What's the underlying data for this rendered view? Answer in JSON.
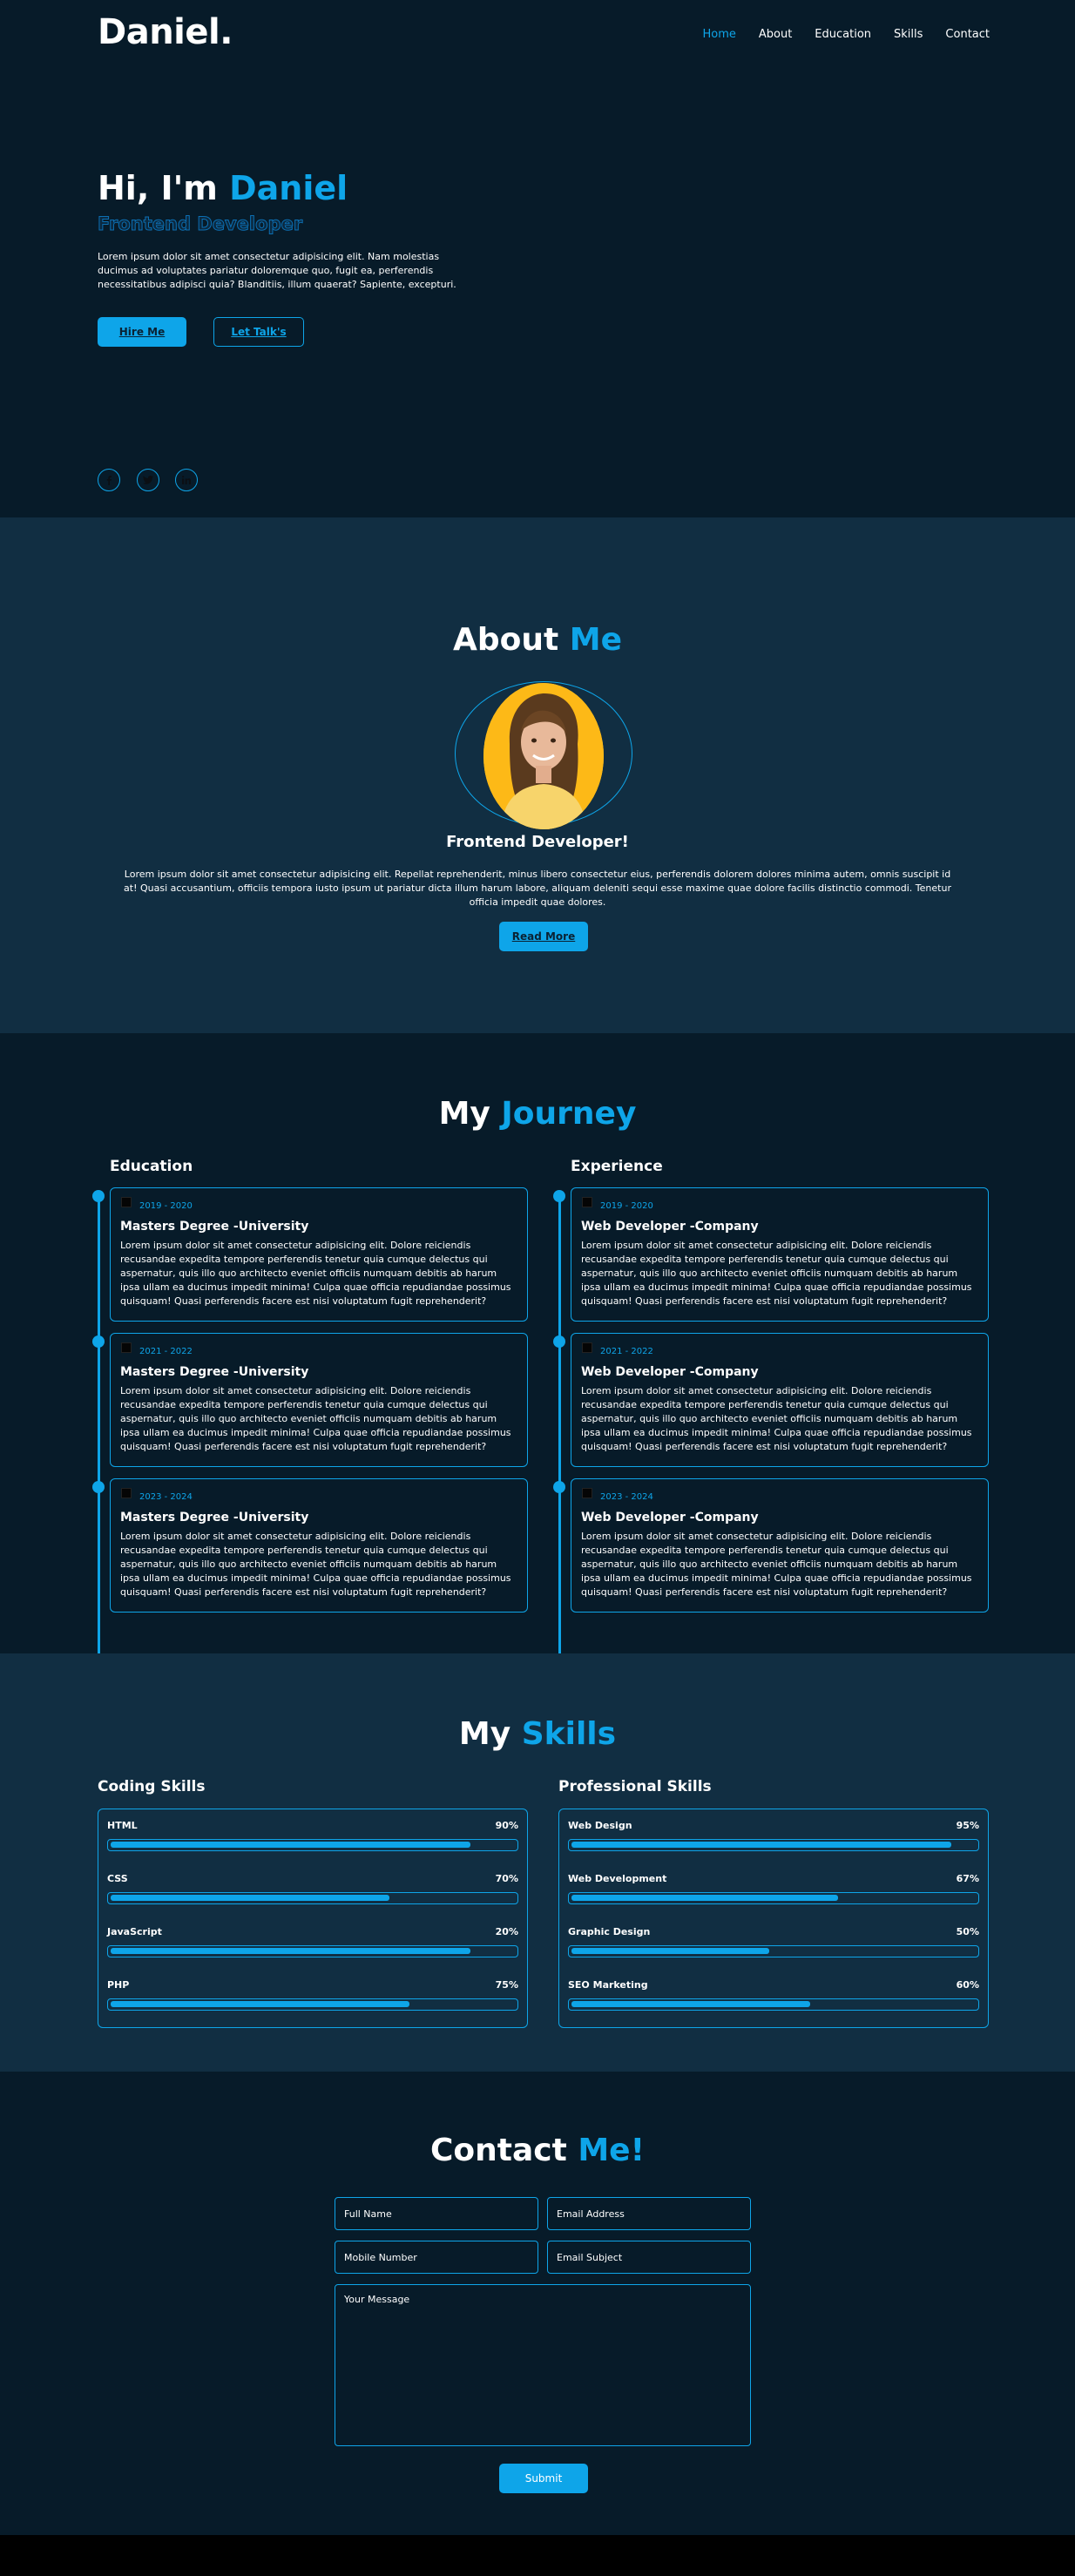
{
  "brand": {
    "logo": "Daniel.",
    "accent": "#0ea5e9"
  },
  "nav": [
    {
      "label": "Home",
      "active": true
    },
    {
      "label": "About",
      "active": false
    },
    {
      "label": "Education",
      "active": false
    },
    {
      "label": "Skills",
      "active": false
    },
    {
      "label": "Contact",
      "active": false
    }
  ],
  "hero": {
    "greeting": "Hi, I'm",
    "name": "Daniel",
    "role": "Frontend Developer",
    "description": "Lorem ipsum dolor sit amet consectetur adipisicing elit. Nam molestias ducimus ad voluptates pariatur doloremque quo, fugit ea, perferendis necessitatibus adipisci quia? Blanditiis, illum quaerat? Sapiente, excepturi.",
    "hire_button": "Hire Me",
    "talk_button": "Let Talk's",
    "social": [
      "facebook-icon",
      "twitter-icon",
      "linkedin-icon"
    ]
  },
  "about": {
    "title": "About",
    "title_accent": "Me",
    "role": "Frontend Developer!",
    "description": "Lorem ipsum dolor sit amet consectetur adipisicing elit. Repellat reprehenderit, minus libero consectetur eius, perferendis dolorem dolores minima autem, omnis suscipit id at! Quasi accusantium, officiis tempora iusto ipsum ut pariatur dicta illum harum labore, aliquam deleniti sequi esse maxime quae dolore facilis distinctio commodi. Tenetur officia impedit quae dolores.",
    "read_more": "Read More"
  },
  "journey": {
    "title": "My",
    "title_accent": "Journey",
    "education": {
      "heading": "Education",
      "items": [
        {
          "date": "2019 - 2020",
          "title": "Masters Degree -University",
          "text": "Lorem ipsum dolor sit amet consectetur adipisicing elit. Dolore reiciendis recusandae expedita tempore perferendis tenetur quia cumque delectus qui aspernatur, quis illo quo architecto eveniet officiis numquam debitis ab harum ipsa ullam ea ducimus impedit minima! Culpa quae officia repudiandae possimus quisquam! Quasi perferendis facere est nisi voluptatum fugit reprehenderit?"
        },
        {
          "date": "2021 - 2022",
          "title": "Masters Degree -University",
          "text": "Lorem ipsum dolor sit amet consectetur adipisicing elit. Dolore reiciendis recusandae expedita tempore perferendis tenetur quia cumque delectus qui aspernatur, quis illo quo architecto eveniet officiis numquam debitis ab harum ipsa ullam ea ducimus impedit minima! Culpa quae officia repudiandae possimus quisquam! Quasi perferendis facere est nisi voluptatum fugit reprehenderit?"
        },
        {
          "date": "2023 - 2024",
          "title": "Masters Degree -University",
          "text": "Lorem ipsum dolor sit amet consectetur adipisicing elit. Dolore reiciendis recusandae expedita tempore perferendis tenetur quia cumque delectus qui aspernatur, quis illo quo architecto eveniet officiis numquam debitis ab harum ipsa ullam ea ducimus impedit minima! Culpa quae officia repudiandae possimus quisquam! Quasi perferendis facere est nisi voluptatum fugit reprehenderit?"
        }
      ]
    },
    "experience": {
      "heading": "Experience",
      "items": [
        {
          "date": "2019 - 2020",
          "title": "Web Developer -Company",
          "text": "Lorem ipsum dolor sit amet consectetur adipisicing elit. Dolore reiciendis recusandae expedita tempore perferendis tenetur quia cumque delectus qui aspernatur, quis illo quo architecto eveniet officiis numquam debitis ab harum ipsa ullam ea ducimus impedit minima! Culpa quae officia repudiandae possimus quisquam! Quasi perferendis facere est nisi voluptatum fugit reprehenderit?"
        },
        {
          "date": "2021 - 2022",
          "title": "Web Developer -Company",
          "text": "Lorem ipsum dolor sit amet consectetur adipisicing elit. Dolore reiciendis recusandae expedita tempore perferendis tenetur quia cumque delectus qui aspernatur, quis illo quo architecto eveniet officiis numquam debitis ab harum ipsa ullam ea ducimus impedit minima! Culpa quae officia repudiandae possimus quisquam! Quasi perferendis facere est nisi voluptatum fugit reprehenderit?"
        },
        {
          "date": "2023 - 2024",
          "title": "Web Developer -Company",
          "text": "Lorem ipsum dolor sit amet consectetur adipisicing elit. Dolore reiciendis recusandae expedita tempore perferendis tenetur quia cumque delectus qui aspernatur, quis illo quo architecto eveniet officiis numquam debitis ab harum ipsa ullam ea ducimus impedit minima! Culpa quae officia repudiandae possimus quisquam! Quasi perferendis facere est nisi voluptatum fugit reprehenderit?"
        }
      ]
    }
  },
  "skills": {
    "title": "My",
    "title_accent": "Skills",
    "coding": {
      "heading": "Coding Skills",
      "items": [
        {
          "name": "HTML",
          "percent_label": "90%",
          "bar_fill": 0.89
        },
        {
          "name": "CSS",
          "percent_label": "70%",
          "bar_fill": 0.69
        },
        {
          "name": "JavaScript",
          "percent_label": "20%",
          "bar_fill": 0.89
        },
        {
          "name": "PHP",
          "percent_label": "75%",
          "bar_fill": 0.74
        }
      ]
    },
    "professional": {
      "heading": "Professional Skills",
      "items": [
        {
          "name": "Web Design",
          "percent_label": "95%",
          "bar_fill": 0.94
        },
        {
          "name": "Web Development",
          "percent_label": "67%",
          "bar_fill": 0.66
        },
        {
          "name": "Graphic Design",
          "percent_label": "50%",
          "bar_fill": 0.49
        },
        {
          "name": "SEO Marketing",
          "percent_label": "60%",
          "bar_fill": 0.59
        }
      ]
    }
  },
  "contact": {
    "title": "Contact",
    "title_accent": "Me!",
    "full_name": "Full Name",
    "email": "Email Address",
    "mobile": "Mobile Number",
    "subject": "Email Subject",
    "message": "Your Message",
    "submit": "Submit"
  }
}
